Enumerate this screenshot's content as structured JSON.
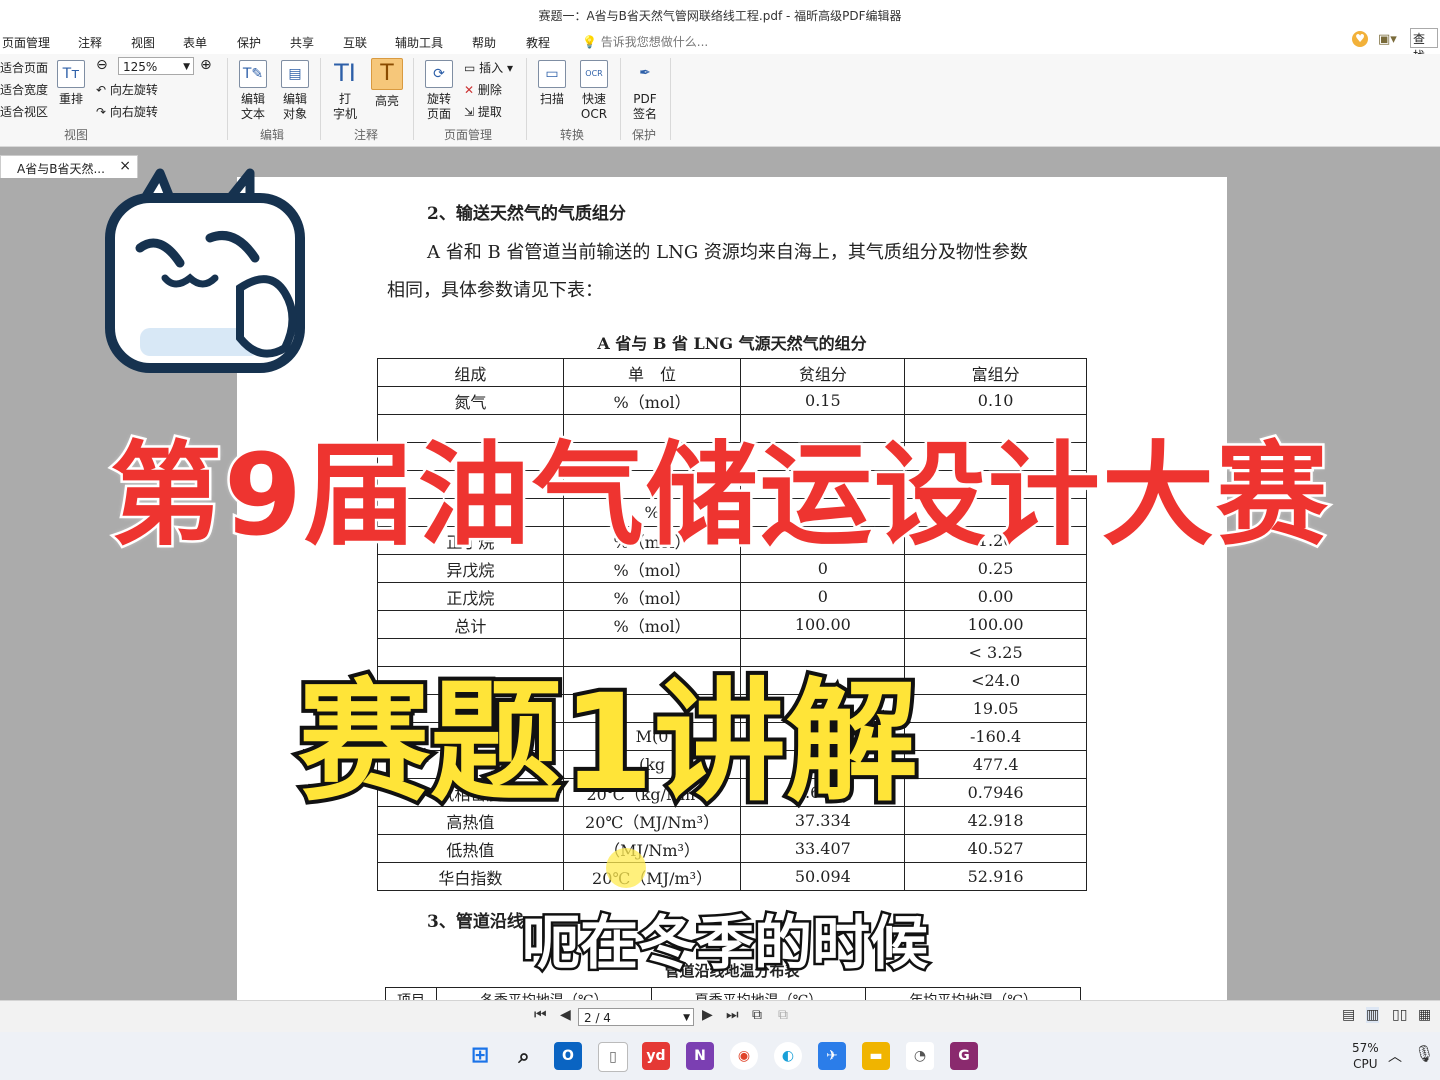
{
  "window": {
    "title": "赛题一：A省与B省天然气管网联络线工程.pdf - 福昕高级PDF编辑器"
  },
  "menu": {
    "items": [
      "页面管理",
      "注释",
      "视图",
      "表单",
      "保护",
      "共享",
      "互联",
      "辅助工具",
      "帮助",
      "教程"
    ],
    "tell_me": "告诉我您想做什么...",
    "find": "查找"
  },
  "ribbon": {
    "view": {
      "fit_page": "适合页面",
      "fit_width": "适合宽度",
      "fit_visible": "适合视区",
      "reflow": "重排",
      "zoom": "125%",
      "rotate_left": "向左旋转",
      "rotate_right": "向右旋转",
      "group": "视图"
    },
    "edit": {
      "edit_text": "编辑\n文本",
      "edit_object": "编辑\n对象",
      "group": "编辑"
    },
    "comment": {
      "typewriter": "打\n字机",
      "highlight": "高亮",
      "group": "注释"
    },
    "pages": {
      "rotate_page": "旋转\n页面",
      "insert": "插入",
      "delete": "删除",
      "extract": "提取",
      "group": "页面管理"
    },
    "convert": {
      "scan": "扫描",
      "quick_ocr": "快速\nOCR",
      "group": "转换"
    },
    "protect": {
      "pdf_sign": "PDF\n签名",
      "group": "保护"
    }
  },
  "tab": {
    "label": "A省与B省天然...",
    "close": "×"
  },
  "doc": {
    "heading2": "2、输送天然气的气质组分",
    "para1": "A 省和 B 省管道当前输送的 LNG 资源均来自海上，其气质组分及物性参数",
    "para2": "相同，具体参数请见下表：",
    "table_caption": "A 省与 B 省 LNG 气源天然气的组分",
    "table_header": [
      "组成",
      "单　位",
      "贫组分",
      "富组分"
    ],
    "rows": [
      [
        "氮气",
        "%（mol）",
        "0.15",
        "0.10"
      ],
      [
        "",
        "",
        "",
        ""
      ],
      [
        "",
        "",
        "",
        ""
      ],
      [
        "",
        "",
        "",
        ""
      ],
      [
        "",
        "%",
        "",
        ""
      ],
      [
        "正丁烷",
        "%（mol）",
        "0",
        "1.20"
      ],
      [
        "异戊烷",
        "%（mol）",
        "0",
        "0.25"
      ],
      [
        "正戊烷",
        "%（mol）",
        "0",
        "0.00"
      ],
      [
        "总计",
        "%（mol）",
        "100.00",
        "100.00"
      ],
      [
        "",
        "",
        "",
        "< 3.25"
      ],
      [
        "",
        "",
        "",
        "<24.0"
      ],
      [
        "",
        "",
        "",
        "19.05"
      ],
      [
        "",
        "M(0",
        "",
        "-160.4"
      ],
      [
        "",
        "(kg",
        "",
        "477.4"
      ],
      [
        "气相密度",
        "20℃（kg/Nm³）",
        "0.6693",
        "0.7946"
      ],
      [
        "高热值",
        "20℃（MJ/Nm³）",
        "37.334",
        "42.918"
      ],
      [
        "低热值",
        "（MJ/Nm³）",
        "33.407",
        "40.527"
      ],
      [
        "华白指数",
        "20℃（MJ/m³）",
        "50.094",
        "52.916"
      ]
    ],
    "heading3": "3、管道沿线",
    "table2_caption": "管道沿线地温分布表",
    "table2_header": [
      "项目",
      "冬季平均地温（℃）",
      "夏季平均地温（℃）",
      "年均平均地温（℃）"
    ]
  },
  "overlay": {
    "main_title": "第9届油气储运设计大赛",
    "sub_title": "赛题1讲解",
    "caption": "呃在冬季的时候"
  },
  "status": {
    "page": "2 / 4"
  },
  "taskbar": {
    "cpu_pct": "57%",
    "cpu_label": "CPU"
  }
}
